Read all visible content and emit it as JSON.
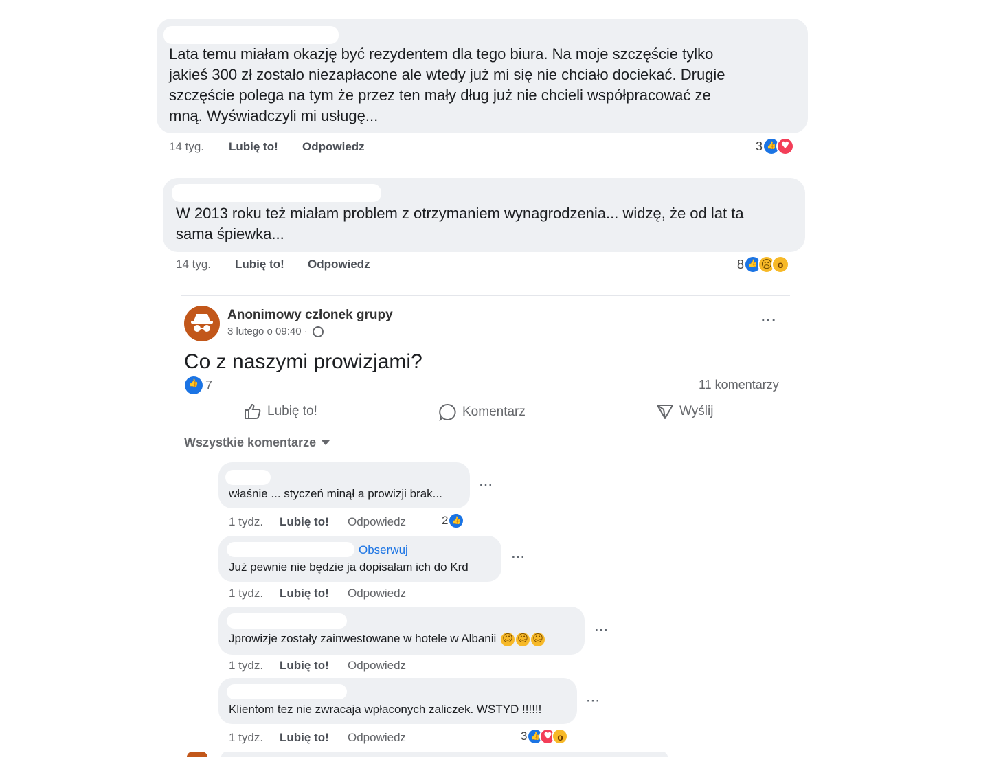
{
  "top_comments": [
    {
      "text_lines": [
        "Lata temu miałam okazję być rezydentem dla tego biura. Na moje szczęście tylko",
        "jakieś 300 zł zostało niezapłacone ale wtedy już mi się nie chciało dociekać. Drugie",
        "szczęście polega na tym że przez ten mały dług już nie chcieli współpracować ze",
        "mną. Wyświadczyli mi usługę..."
      ],
      "time": "14 tyg.",
      "like_label": "Lubię to!",
      "reply_label": "Odpowiedz",
      "reaction_count": "3",
      "reactions": [
        "like-icon",
        "heart-icon"
      ]
    },
    {
      "text_lines": [
        "W 2013 roku też miałam problem z otrzymaniem wynagrodzenia... widzę, że od lat ta",
        "sama śpiewka..."
      ],
      "time": "14 tyg.",
      "like_label": "Lubię to!",
      "reply_label": "Odpowiedz",
      "reaction_count": "8",
      "reactions": [
        "like-icon",
        "sad-icon",
        "wow-icon"
      ]
    }
  ],
  "post": {
    "author": "Anonimowy członek grupy",
    "timestamp": "3 lutego o 09:40 ·",
    "title": "Co z naszymi prowizjami?",
    "reaction_count": "7",
    "comments_count": "11 komentarzy",
    "actions": {
      "like": "Lubię to!",
      "comment": "Komentarz",
      "send": "Wyślij"
    },
    "filter_label": "Wszystkie komentarze"
  },
  "replies": [
    {
      "text": "właśnie ... styczeń minął a prowizji brak...",
      "time": "1 tydz.",
      "like_label": "Lubię to!",
      "reply_label": "Odpowiedz",
      "reaction_count": "2",
      "follow_label": ""
    },
    {
      "text": "Już pewnie nie będzie ja dopisałam ich do Krd",
      "time": "1 tydz.",
      "like_label": "Lubię to!",
      "reply_label": "Odpowiedz",
      "reaction_count": "",
      "follow_label": "Obserwuj"
    },
    {
      "text": "Jprowizje zostały zainwestowane w hotele w Albanii",
      "time": "1 tydz.",
      "like_label": "Lubię to!",
      "reply_label": "Odpowiedz",
      "reaction_count": "",
      "follow_label": ""
    },
    {
      "text": "Klientom tez nie zwracaja wpłaconych zaliczek. WSTYD !!!!!!",
      "time": "1 tydz.",
      "like_label": "Lubię to!",
      "reply_label": "Odpowiedz",
      "reaction_count": "3",
      "follow_label": ""
    }
  ],
  "colors": {
    "bubble": "#eef0f3",
    "link_blue": "#1b74e4",
    "avatar": "#c2571a",
    "meta_text": "#65676b"
  }
}
